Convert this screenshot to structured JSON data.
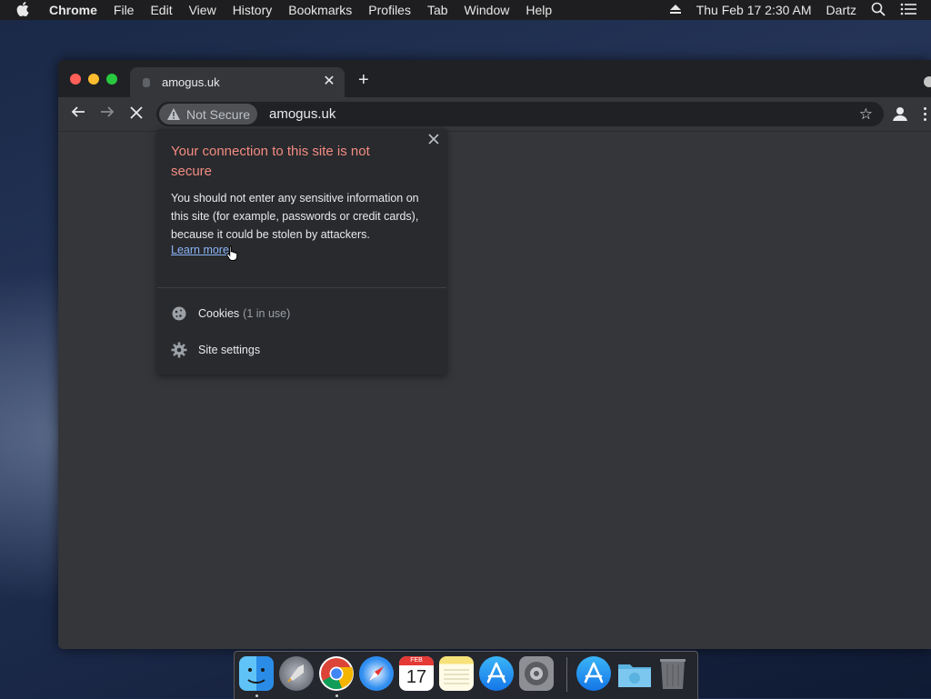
{
  "menubar": {
    "app": "Chrome",
    "items": [
      "File",
      "Edit",
      "View",
      "History",
      "Bookmarks",
      "Profiles",
      "Tab",
      "Window",
      "Help"
    ],
    "datetime": "Thu Feb 17  2:30 AM",
    "user": "Dartz"
  },
  "tab": {
    "title": "amogus.uk",
    "close": "✕",
    "new": "+"
  },
  "omnibox": {
    "security_chip": "Not Secure",
    "url": "amogus.uk"
  },
  "popup": {
    "title": "Your connection to this site is not secure",
    "body": "You should not enter any sensitive information on this site (for example, passwords or credit cards), because it could be stolen by attackers.",
    "learn_more": "Learn more",
    "cookies_label": "Cookies",
    "cookies_detail": "(1 in use)",
    "site_settings_label": "Site settings"
  },
  "dock": {
    "calendar_month": "FEB",
    "calendar_day": "17",
    "apps": [
      "finder-icon",
      "launchpad-icon",
      "chrome-icon",
      "safari-icon",
      "calendar-icon",
      "notes-icon",
      "app-store-icon",
      "system-preferences-icon",
      "app-store-icon",
      "downloads-folder-icon",
      "trash-icon"
    ]
  },
  "colors": {
    "menubar": "#1e1e20",
    "tabstrip": "#202124",
    "toolbar": "#35363a",
    "popup_bg": "#292a2d",
    "warning_title": "#f28b82",
    "link": "#8ab4f8"
  }
}
